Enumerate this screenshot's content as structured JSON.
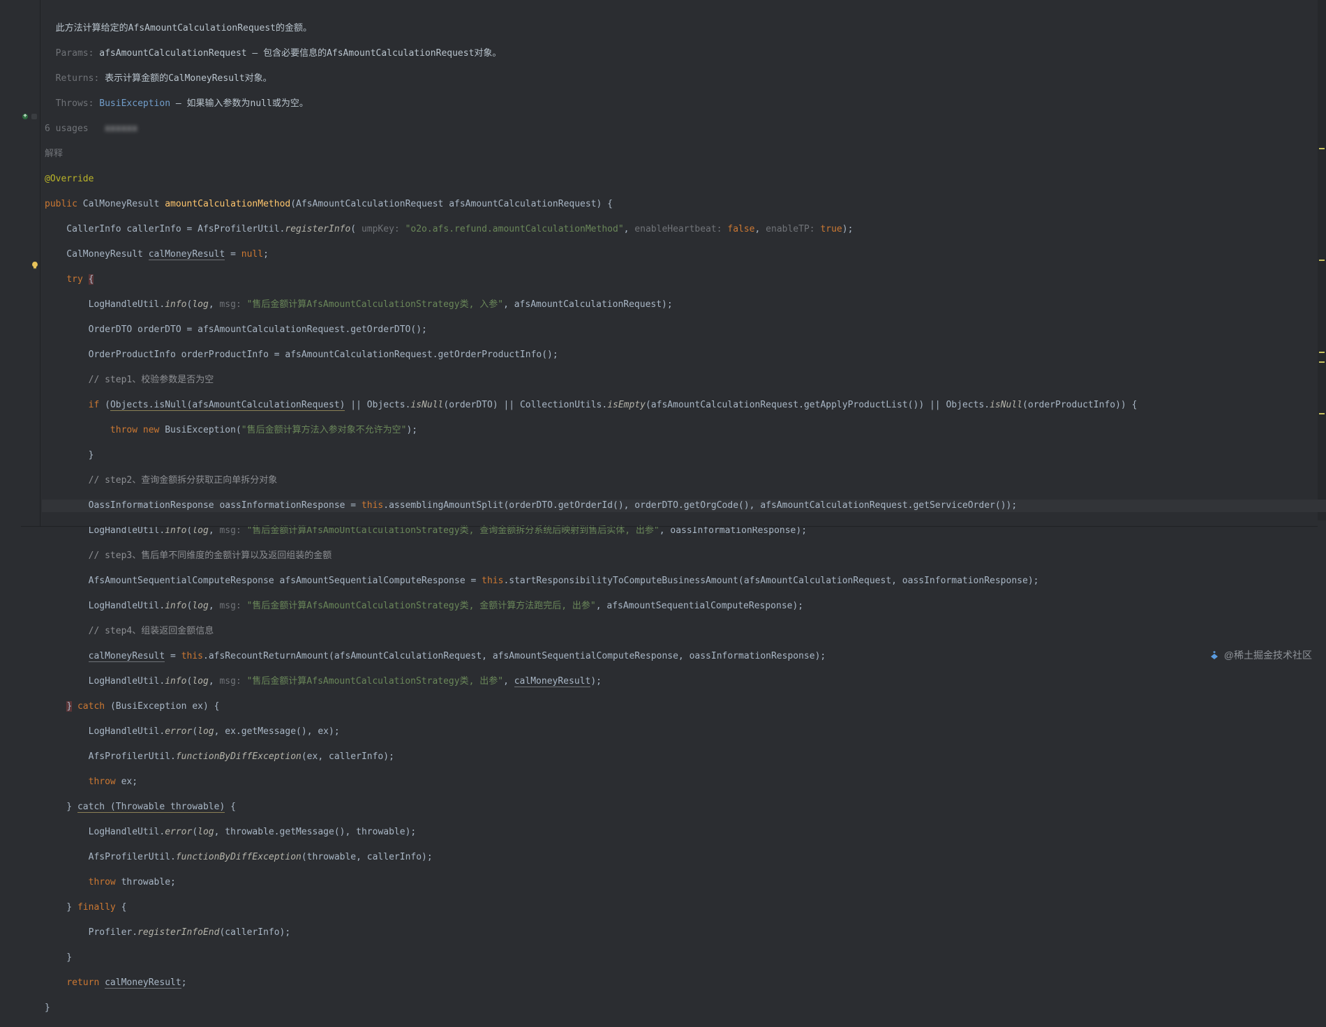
{
  "doc": {
    "summary": "此方法计算给定的AfsAmountCalculationRequest的金额。",
    "params_label": "Params:",
    "params_text": "afsAmountCalculationRequest – 包含必要信息的AfsAmountCalculationRequest对象。",
    "returns_label": "Returns:",
    "returns_text": "表示计算金额的CalMoneyResult对象。",
    "throws_label": "Throws:",
    "throws_ex": "BusiException",
    "throws_text": " – 如果输入参数为null或为空。"
  },
  "meta": {
    "usages": "6 usages",
    "author_blur": "xxxxxx",
    "explain": "解释"
  },
  "code": {
    "override": "@Override",
    "sig_public": "public ",
    "sig_type": "CalMoneyResult ",
    "sig_name": "amountCalculationMethod",
    "sig_paren_open": "(",
    "sig_pt": "AfsAmountCalculationRequest ",
    "sig_pn": "afsAmountCalculationRequest",
    "sig_paren_close": ") {",
    "l1_a": "    CallerInfo callerInfo = AfsProfilerUtil.",
    "l1_m": "registerInfo",
    "l1_b": "(",
    "l1_h1": " umpKey: ",
    "l1_s": "\"o2o.afs.refund.amountCalculationMethod\"",
    "l1_c": ",",
    "l1_h2": " enableHeartbeat: ",
    "l1_f": "false",
    "l1_d": ",",
    "l1_h3": " enableTP: ",
    "l1_t": "true",
    "l1_e": ");",
    "l2_a": "    CalMoneyResult ",
    "l2_u": "calMoneyResult",
    "l2_b": " = ",
    "l2_n": "null",
    "l2_c": ";",
    "l3_a": "    ",
    "l3_try": "try ",
    "l3_ob": "{",
    "l4_a": "        LogHandleUtil.",
    "l4_m": "info",
    "l4_b": "(",
    "l4_i": "log",
    "l4_c": ",",
    "l4_h": " msg: ",
    "l4_s": "\"售后金额计算AfsAmountCalculationStrategy类, 入参\"",
    "l4_d": ", afsAmountCalculationRequest);",
    "l5": "        OrderDTO orderDTO = afsAmountCalculationRequest.getOrderDTO();",
    "l6": "        OrderProductInfo orderProductInfo = afsAmountCalculationRequest.getOrderProductInfo();",
    "c1": "        // step1、校验参数是否为空",
    "l7_a": "        ",
    "l7_if": "if ",
    "l7_b": "(",
    "l7_u": "Objects.isNull(afsAmountCalculationRequest)",
    "l7_c": " || Objects.",
    "l7_m1": "isNull",
    "l7_d": "(orderDTO) || CollectionUtils.",
    "l7_m2": "isEmpty",
    "l7_e": "(afsAmountCalculationRequest.getApplyProductList()) || Objects.",
    "l7_m3": "isNull",
    "l7_f": "(orderProductInfo)) {",
    "l8_a": "            ",
    "l8_k": "throw new ",
    "l8_t": "BusiException(",
    "l8_s": "\"售后金额计算方法入参对象不允许为空\"",
    "l8_e": ");",
    "l9": "        }",
    "c2": "        // step2、查询金额拆分获取正向单拆分对象",
    "l10_a": "        OassInformationResponse oassInformationResponse = ",
    "l10_this": "this",
    "l10_dot": ".",
    "l10_m": "assemblingAmountSplit",
    "l10_b": "(orderDTO.getOrderId(), orderDTO.getOrgCode(), afsAmountCalculationRequest.getServiceOrder());",
    "l10_tail": "                                                                                                               ",
    "l11_a": "        LogHandleUtil.",
    "l11_m": "info",
    "l11_b": "(",
    "l11_i": "log",
    "l11_c": ",",
    "l11_h": " msg: ",
    "l11_s": "\"售后金额计算AfsAmoUntCalculationStrategy类, 查询金额拆分系统后映射到售后实体, 出参\"",
    "l11_d": ", oassInformationResponse);",
    "c3": "        // step3、售后单不同维度的金额计算以及返回组装的金额",
    "l12_a": "        AfsAmountSequentialComputeResponse afsAmountSequentialComputeResponse = ",
    "l12_this": "this",
    "l12_b": ".startResponsibilityToComputeBusinessAmount(afsAmountCalculationRequest, oassInformationResponse);",
    "l13_a": "        LogHandleUtil.",
    "l13_m": "info",
    "l13_b": "(",
    "l13_i": "log",
    "l13_c": ",",
    "l13_h": " msg: ",
    "l13_s": "\"售后金额计算AfsAmountCalculationStrategy类, 金额计算方法跑完后, 出参\"",
    "l13_d": ", afsAmountSequentialComputeResponse);",
    "c4": "        // step4、组装返回金额信息",
    "l14_a": "        ",
    "l14_u": "calMoneyResult",
    "l14_b": " = ",
    "l14_this": "this",
    "l14_c": ".afsRecountReturnAmount(afsAmountCalculationRequest, afsAmountSequentialComputeResponse, oassInformationResponse);",
    "l15_a": "        LogHandleUtil.",
    "l15_m": "info",
    "l15_b": "(",
    "l15_i": "log",
    "l15_c": ",",
    "l15_h": " msg: ",
    "l15_s": "\"售后金额计算AfsAmountCalculationStrategy类, 出参\"",
    "l15_d": ", ",
    "l15_u": "calMoneyResult",
    "l15_e": ");",
    "l16_a": "    ",
    "l16_cb": "}",
    "l16_catch": " catch ",
    "l16_b": "(BusiException ex) {",
    "l17_a": "        LogHandleUtil.",
    "l17_m": "error",
    "l17_b": "(",
    "l17_i": "log",
    "l17_c": ", ex.getMessage(), ex);",
    "l18_a": "        AfsProfilerUtil.",
    "l18_m": "functionByDiffException",
    "l18_b": "(ex, callerInfo);",
    "l19_a": "        ",
    "l19_k": "throw ",
    "l19_b": "ex;",
    "l20_a": "    } ",
    "l20_u": "catch (Throwable throwable)",
    "l20_b": " {",
    "l21_a": "        LogHandleUtil.",
    "l21_m": "error",
    "l21_b": "(",
    "l21_i": "log",
    "l21_c": ", throwable.getMessage(), throwable);",
    "l22_a": "        AfsProfilerUtil.",
    "l22_m": "functionByDiffException",
    "l22_b": "(throwable, callerInfo);",
    "l23_a": "        ",
    "l23_k": "throw ",
    "l23_b": "throwable;",
    "l24_a": "    } ",
    "l24_k": "finally ",
    "l24_b": "{",
    "l25_a": "        Profiler.",
    "l25_m": "registerInfoEnd",
    "l25_b": "(callerInfo);",
    "l26": "    }",
    "l27_a": "    ",
    "l27_k": "return ",
    "l27_u": "calMoneyResult",
    "l27_b": ";",
    "l28": "}"
  },
  "footer": "@稀土掘金技术社区",
  "icons": {
    "override": "override-icon",
    "bulb": "intention-bulb-icon",
    "logo": "juejin-logo-icon"
  }
}
